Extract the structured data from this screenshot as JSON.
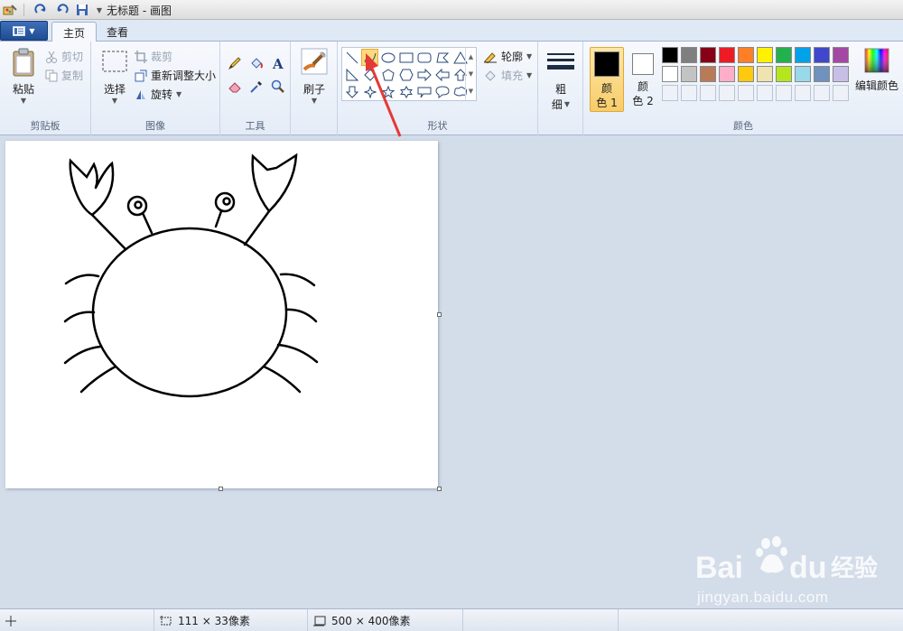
{
  "window": {
    "title": "无标题 - 画图"
  },
  "tabs": {
    "home": "主页",
    "view": "查看"
  },
  "clipboard": {
    "paste": "粘贴",
    "cut": "剪切",
    "copy": "复制",
    "group": "剪贴板"
  },
  "image": {
    "select": "选择",
    "crop": "裁剪",
    "resize": "重新调整大小",
    "rotate": "旋转",
    "group": "图像"
  },
  "tools": {
    "group": "工具"
  },
  "brushes": {
    "label": "刷子"
  },
  "shapes": {
    "outline": "轮廓",
    "fill": "填充",
    "group": "形状",
    "selected": "curve"
  },
  "size": {
    "label_top": "粗",
    "label_bottom": "细"
  },
  "colors": {
    "color1_top": "颜",
    "color1_bottom": "色 1",
    "color2_top": "颜",
    "color2_bottom": "色 2",
    "edit": "编辑颜色",
    "group": "颜色",
    "color1": "#000000",
    "color2": "#ffffff",
    "palette_row1": [
      "#000000",
      "#7f7f7f",
      "#880015",
      "#ed1c24",
      "#ff7f27",
      "#fff200",
      "#22b14c",
      "#00a2e8",
      "#3f48cc",
      "#a349a4"
    ],
    "palette_row2": [
      "#ffffff",
      "#c3c3c3",
      "#b97a57",
      "#ffaec9",
      "#ffc90e",
      "#efe4b0",
      "#b5e61d",
      "#99d9ea",
      "#7092be",
      "#c8bfe7"
    ]
  },
  "status": {
    "selection_size": "111 × 33像素",
    "canvas_size": "500 × 400像素"
  },
  "watermark": {
    "brand": "Bai du 经验",
    "url": "jingyan.baidu.com"
  }
}
